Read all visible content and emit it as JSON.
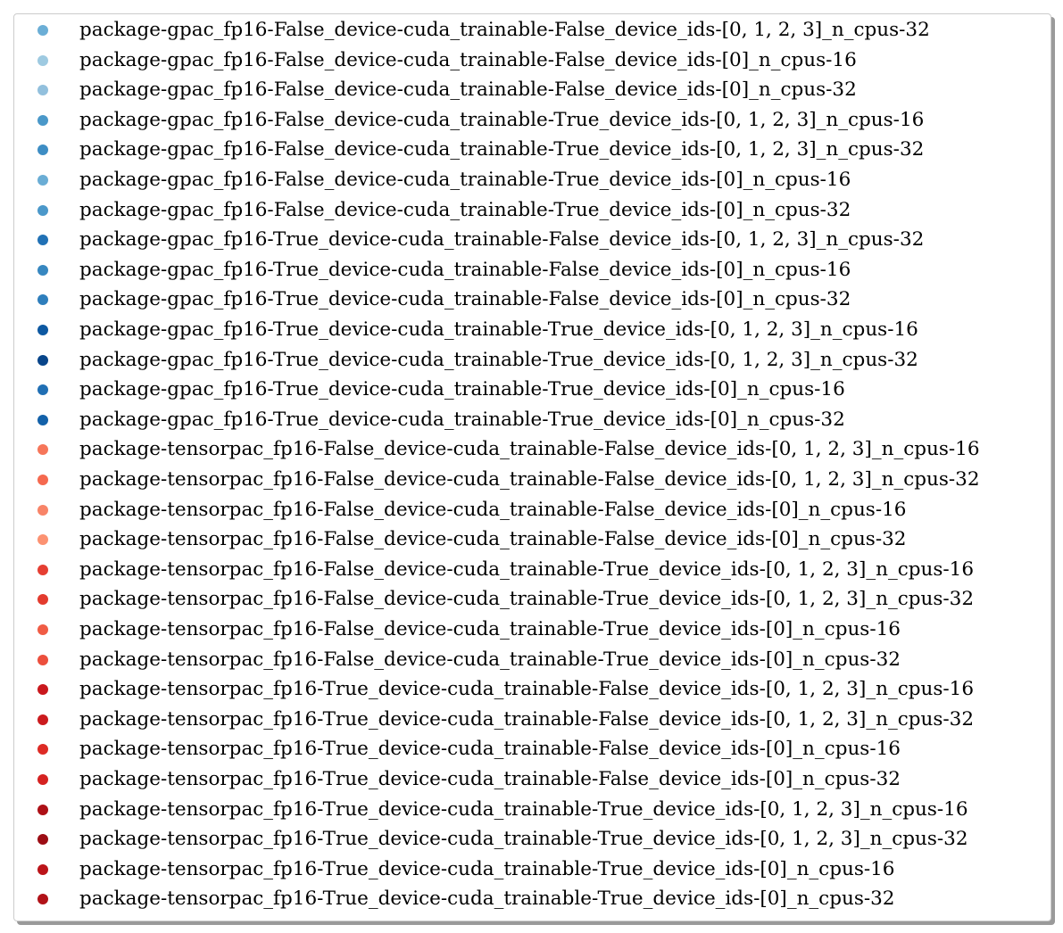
{
  "chart_data": {
    "type": "scatter",
    "title": "",
    "xlabel": "",
    "ylabel": "",
    "legend": {
      "placement": "full-figure",
      "entries": [
        {
          "name": "package-gpac_fp16-False_device-cuda_trainable-False_device_ids-[0, 1, 2, 3]_n_cpus-32",
          "color": "#6baed6"
        },
        {
          "name": "package-gpac_fp16-False_device-cuda_trainable-False_device_ids-[0]_n_cpus-16",
          "color": "#9ecae1"
        },
        {
          "name": "package-gpac_fp16-False_device-cuda_trainable-False_device_ids-[0]_n_cpus-32",
          "color": "#92c0dd"
        },
        {
          "name": "package-gpac_fp16-False_device-cuda_trainable-True_device_ids-[0, 1, 2, 3]_n_cpus-16",
          "color": "#4a98c9"
        },
        {
          "name": "package-gpac_fp16-False_device-cuda_trainable-True_device_ids-[0, 1, 2, 3]_n_cpus-32",
          "color": "#3d8dc4"
        },
        {
          "name": "package-gpac_fp16-False_device-cuda_trainable-True_device_ids-[0]_n_cpus-16",
          "color": "#6aadd5"
        },
        {
          "name": "package-gpac_fp16-False_device-cuda_trainable-True_device_ids-[0]_n_cpus-32",
          "color": "#4b98ca"
        },
        {
          "name": "package-gpac_fp16-True_device-cuda_trainable-False_device_ids-[0, 1, 2, 3]_n_cpus-32",
          "color": "#2171b5"
        },
        {
          "name": "package-gpac_fp16-True_device-cuda_trainable-False_device_ids-[0]_n_cpus-16",
          "color": "#3787c0"
        },
        {
          "name": "package-gpac_fp16-True_device-cuda_trainable-False_device_ids-[0]_n_cpus-32",
          "color": "#2e7ebc"
        },
        {
          "name": "package-gpac_fp16-True_device-cuda_trainable-True_device_ids-[0, 1, 2, 3]_n_cpus-16",
          "color": "#0d58a1"
        },
        {
          "name": "package-gpac_fp16-True_device-cuda_trainable-True_device_ids-[0, 1, 2, 3]_n_cpus-32",
          "color": "#08458a"
        },
        {
          "name": "package-gpac_fp16-True_device-cuda_trainable-True_device_ids-[0]_n_cpus-16",
          "color": "#206fb4"
        },
        {
          "name": "package-gpac_fp16-True_device-cuda_trainable-True_device_ids-[0]_n_cpus-32",
          "color": "#1361a9"
        },
        {
          "name": "package-tensorpac_fp16-False_device-cuda_trainable-False_device_ids-[0, 1, 2, 3]_n_cpus-16",
          "color": "#f6765a"
        },
        {
          "name": "package-tensorpac_fp16-False_device-cuda_trainable-False_device_ids-[0, 1, 2, 3]_n_cpus-32",
          "color": "#f5694f"
        },
        {
          "name": "package-tensorpac_fp16-False_device-cuda_trainable-False_device_ids-[0]_n_cpus-16",
          "color": "#f88468"
        },
        {
          "name": "package-tensorpac_fp16-False_device-cuda_trainable-False_device_ids-[0]_n_cpus-32",
          "color": "#fc9272"
        },
        {
          "name": "package-tensorpac_fp16-False_device-cuda_trainable-True_device_ids-[0, 1, 2, 3]_n_cpus-16",
          "color": "#e53e32"
        },
        {
          "name": "package-tensorpac_fp16-False_device-cuda_trainable-True_device_ids-[0, 1, 2, 3]_n_cpus-32",
          "color": "#e33b2e"
        },
        {
          "name": "package-tensorpac_fp16-False_device-cuda_trainable-True_device_ids-[0]_n_cpus-16",
          "color": "#f05c45"
        },
        {
          "name": "package-tensorpac_fp16-False_device-cuda_trainable-True_device_ids-[0]_n_cpus-32",
          "color": "#ec4f3d"
        },
        {
          "name": "package-tensorpac_fp16-True_device-cuda_trainable-False_device_ids-[0, 1, 2, 3]_n_cpus-16",
          "color": "#c9181d"
        },
        {
          "name": "package-tensorpac_fp16-True_device-cuda_trainable-False_device_ids-[0, 1, 2, 3]_n_cpus-32",
          "color": "#cb1b1e"
        },
        {
          "name": "package-tensorpac_fp16-True_device-cuda_trainable-False_device_ids-[0]_n_cpus-16",
          "color": "#dd2b25"
        },
        {
          "name": "package-tensorpac_fp16-True_device-cuda_trainable-False_device_ids-[0]_n_cpus-32",
          "color": "#d52221"
        },
        {
          "name": "package-tensorpac_fp16-True_device-cuda_trainable-True_device_ids-[0, 1, 2, 3]_n_cpus-16",
          "color": "#ad1016"
        },
        {
          "name": "package-tensorpac_fp16-True_device-cuda_trainable-True_device_ids-[0, 1, 2, 3]_n_cpus-32",
          "color": "#9c0d14"
        },
        {
          "name": "package-tensorpac_fp16-True_device-cuda_trainable-True_device_ids-[0]_n_cpus-16",
          "color": "#bb1419"
        },
        {
          "name": "package-tensorpac_fp16-True_device-cuda_trainable-True_device_ids-[0]_n_cpus-32",
          "color": "#b11218"
        }
      ]
    }
  }
}
